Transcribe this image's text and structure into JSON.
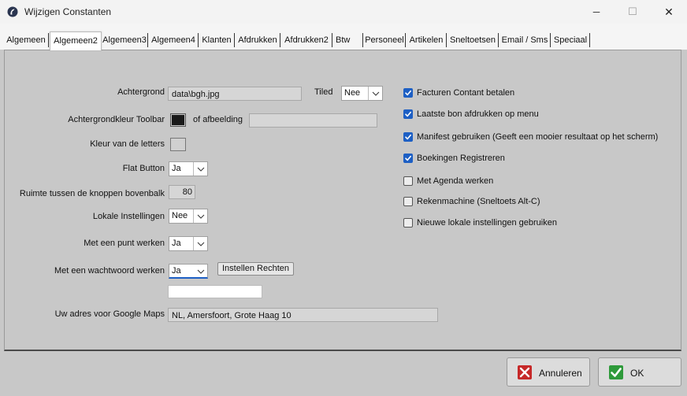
{
  "window": {
    "title": "Wijzigen Constanten",
    "minimize_glyph": "─",
    "maximize_glyph": "☐",
    "close_glyph": "✕"
  },
  "tabs": [
    {
      "label": "Algemeen"
    },
    {
      "label": "Algemeen2",
      "active": true
    },
    {
      "label": "Algemeen3"
    },
    {
      "label": "Algemeen4"
    },
    {
      "label": "Klanten"
    },
    {
      "label": "Afdrukken"
    },
    {
      "label": "Afdrukken2"
    },
    {
      "label": "Btw"
    },
    {
      "label": "Personeel"
    },
    {
      "label": "Artikelen"
    },
    {
      "label": "Sneltoetsen"
    },
    {
      "label": "Email / Sms"
    },
    {
      "label": "Speciaal"
    }
  ],
  "form": {
    "background_label": "Achtergrond",
    "background_value": "data\\bgh.jpg",
    "tiled_label": "Tiled",
    "tiled_value": "Nee",
    "toolbar_color_label": "Achtergrondkleur Toolbar",
    "toolbar_color": "#1a1a1a",
    "or_image_label": "of afbeelding",
    "or_image_value": "",
    "letter_color_label": "Kleur van de letters",
    "letter_color": "#d0d0d0",
    "flat_button_label": "Flat Button",
    "flat_button_value": "Ja",
    "spacing_label": "Ruimte tussen de knoppen bovenbalk",
    "spacing_value": "80",
    "local_settings_label": "Lokale Instellingen",
    "local_settings_value": "Nee",
    "point_label": "Met een punt werken",
    "point_value": "Ja",
    "password_label": "Met een wachtwoord werken",
    "password_value": "Ja",
    "rights_button": "Instellen Rechten",
    "password_field_value": "",
    "maps_label": "Uw adres voor Google Maps",
    "maps_value": "NL, Amersfoort, Grote Haag 10"
  },
  "checkboxes": [
    {
      "label": "Facturen Contant betalen",
      "checked": true
    },
    {
      "label": "Laatste bon afdrukken op menu",
      "checked": true
    },
    {
      "label": "Manifest gebruiken (Geeft een mooier resultaat op het scherm)",
      "checked": true
    },
    {
      "label": "Boekingen Registreren",
      "checked": true
    },
    {
      "label": "Met Agenda werken",
      "checked": false
    },
    {
      "label": "Rekenmachine (Sneltoets Alt-C)",
      "checked": false
    },
    {
      "label": "Nieuwe lokale instellingen gebruiken",
      "checked": false
    }
  ],
  "buttons": {
    "cancel": "Annuleren",
    "ok": "OK"
  },
  "colors": {
    "checkbox_on": "#1d5fc4",
    "cancel_icon": "#c62828",
    "ok_icon": "#2e9a3a"
  }
}
